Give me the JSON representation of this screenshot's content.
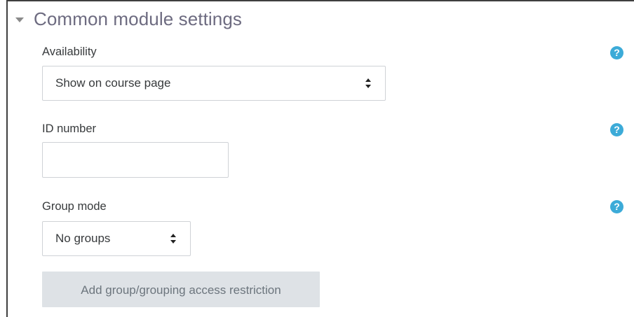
{
  "section": {
    "title": "Common module settings",
    "collapse_icon": "chevron-down-triangle-icon"
  },
  "availability": {
    "label": "Availability",
    "selected": "Show on course page",
    "help_icon": "question-circle-icon",
    "help_glyph": "?"
  },
  "id_number": {
    "label": "ID number",
    "value": "",
    "help_icon": "question-circle-icon",
    "help_glyph": "?"
  },
  "group_mode": {
    "label": "Group mode",
    "selected": "No groups",
    "help_icon": "question-circle-icon",
    "help_glyph": "?"
  },
  "restriction_button": {
    "label": "Add group/grouping access restriction"
  },
  "colors": {
    "title": "#6d6b80",
    "help_icon": "#3cabd8",
    "button_bg": "#dee2e6",
    "button_text": "#6c757d",
    "border": "#cfd2d6"
  }
}
